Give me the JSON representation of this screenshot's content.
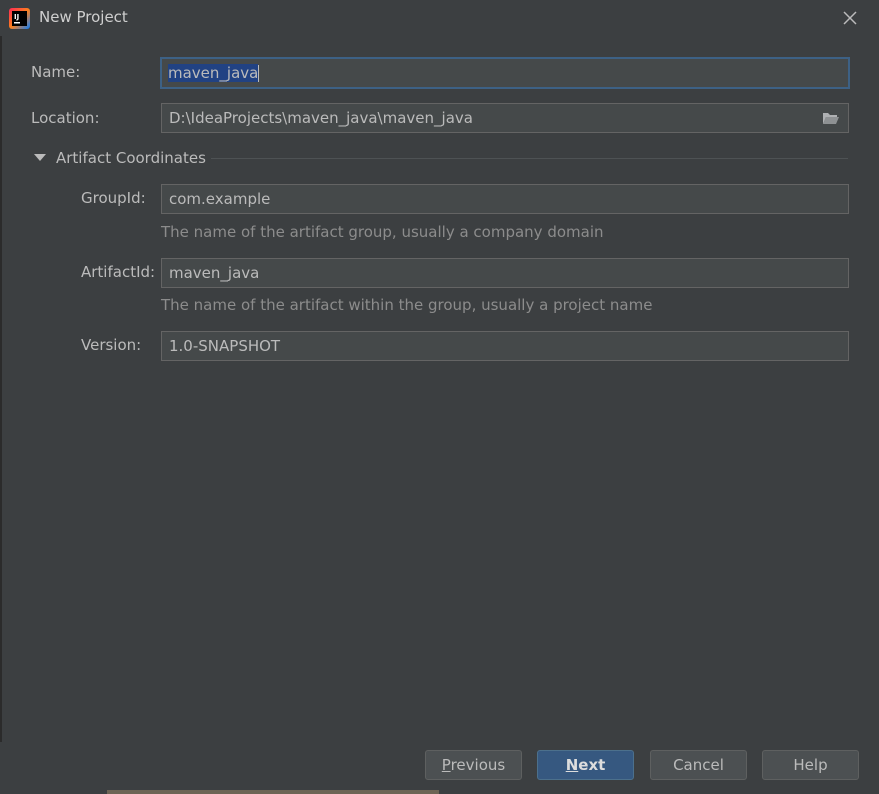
{
  "window": {
    "title": "New Project"
  },
  "form": {
    "name_label": "Name:",
    "name_value": "maven_java",
    "location_label": "Location:",
    "location_value": "D:\\IdeaProjects\\maven_java\\maven_java"
  },
  "artifact": {
    "section_label": "Artifact Coordinates",
    "groupid_label": "GroupId:",
    "groupid_value": "com.example",
    "groupid_hint": "The name of the artifact group, usually a company domain",
    "artifactid_label": "ArtifactId:",
    "artifactid_value": "maven_java",
    "artifactid_hint": "The name of the artifact within the group, usually a project name",
    "version_label": "Version:",
    "version_value": "1.0-SNAPSHOT"
  },
  "buttons": {
    "previous_mnemonic": "P",
    "previous_rest": "revious",
    "next_mnemonic": "N",
    "next_rest": "ext",
    "cancel": "Cancel",
    "help": "Help"
  },
  "icons": {
    "app": "intellij-idea-icon",
    "close": "close-icon",
    "folder": "folder-icon",
    "expand": "triangle-down-icon"
  },
  "colors": {
    "background": "#3c3f41",
    "field_bg": "#45494a",
    "selection": "#214283",
    "primary_button": "#365880",
    "focus_border": "#3d6185"
  }
}
